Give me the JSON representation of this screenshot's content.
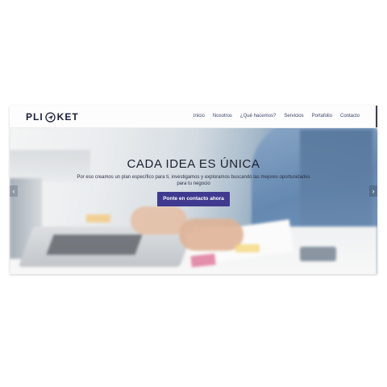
{
  "brand": {
    "logo_left": "PLI",
    "logo_right": "KET",
    "logo_mark": "paper-plane-icon"
  },
  "nav": {
    "items": [
      "Inicio",
      "Nosotros",
      "¿Qué hacemos?",
      "Servicios",
      "Portafolio",
      "Contacto"
    ]
  },
  "hero": {
    "title": "CADA IDEA ES ÚNICA",
    "subtitle": "Por eso creamos un plan específico para ti, investigamos y exploramos buscando las mejores oportunidades para tu negocio",
    "cta": "Ponte en contacto ahora"
  },
  "carousel": {
    "prev_icon": "chevron-left-icon",
    "next_icon": "chevron-right-icon"
  },
  "colors": {
    "cta_bg": "#3f3a8f",
    "brand_text": "#1a1f3a",
    "nav_text": "#3a4468"
  }
}
